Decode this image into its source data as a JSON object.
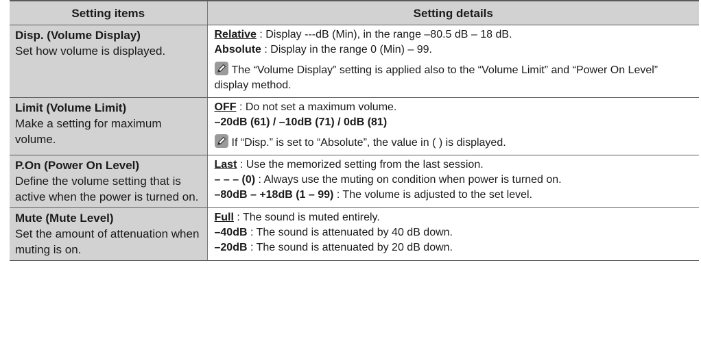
{
  "table": {
    "headers": [
      "Setting items",
      "Setting details"
    ],
    "rows": [
      {
        "item_title": "Disp. (Volume Display)",
        "item_desc": "Set how volume is displayed.",
        "options": [
          {
            "key": "Relative",
            "underline": true,
            "sep": " : ",
            "text": "Display ---dB (Min), in the range –80.5 dB – 18 dB."
          },
          {
            "key": "Absolute",
            "underline": false,
            "sep": " : ",
            "text": "Display in the range 0 (Min) – 99."
          }
        ],
        "note": "The “Volume Display” setting is applied also to the “Volume Limit” and “Power On Level” display method.",
        "note_icon": "pencil-note-icon"
      },
      {
        "item_title": "Limit (Volume Limit)",
        "item_desc": "Make a setting for maximum volume.",
        "options": [
          {
            "key": "OFF",
            "underline": true,
            "sep": " : ",
            "text": "Do not set a maximum volume."
          },
          {
            "key": "–20dB (61) / –10dB (71) / 0dB (81)",
            "underline": false,
            "sep": "",
            "text": ""
          }
        ],
        "note": "If “Disp.” is set to “Absolute”, the value in (  ) is displayed.",
        "note_icon": "pencil-note-icon"
      },
      {
        "item_title": "P.On (Power On Level)",
        "item_desc": "Define the volume setting that is active when the power is turned on.",
        "options": [
          {
            "key": "Last",
            "underline": true,
            "sep": " : ",
            "text": "Use the memorized setting from the last session."
          },
          {
            "key": "– – – (0)",
            "underline": false,
            "sep": " : ",
            "text": "Always use the muting on condition when power is turned on."
          },
          {
            "key": "–80dB – +18dB (1 – 99)",
            "underline": false,
            "sep": " : ",
            "text": "The volume is adjusted to the set level."
          }
        ]
      },
      {
        "item_title": "Mute (Mute Level)",
        "item_desc": "Set the amount of attenuation when muting is on.",
        "options": [
          {
            "key": "Full",
            "underline": true,
            "sep": " : ",
            "text": "The sound is muted entirely."
          },
          {
            "key": "–40dB",
            "underline": false,
            "sep": " : ",
            "text": "The sound is attenuated by 40 dB down."
          },
          {
            "key": "–20dB",
            "underline": false,
            "sep": " : ",
            "text": "The sound is attenuated by 20 dB down."
          }
        ]
      }
    ]
  },
  "colors": {
    "header_bg": "#d2d2d2",
    "item_bg": "#d2d2d2",
    "rule": "#5a5a5a",
    "note_icon_bg": "#9a9a9a"
  }
}
